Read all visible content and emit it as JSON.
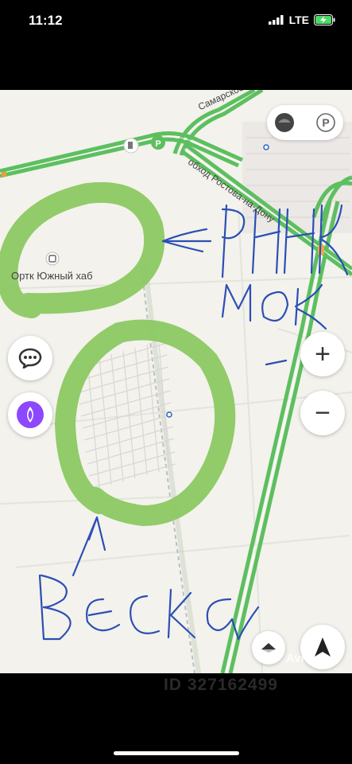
{
  "status_bar": {
    "time": "11:12",
    "network": "LTE"
  },
  "map": {
    "labels": {
      "road_samarskoe": "Самарское",
      "road_bypass": "обход Ростова-на-Дону",
      "poi_hub": "Ортк Южный хаб"
    },
    "handwriting": {
      "annotation_1": "Рынок",
      "annotation_2": "Весна"
    },
    "controls": {
      "zoom_in": "+",
      "zoom_out": "−",
      "chat_icon": "chat-bubble-icon",
      "assistant_icon": "alice-assistant-icon",
      "location_icon": "navigation-arrow-icon",
      "layers_icon": "map-layers-icon",
      "parking_icon": "parking-icon",
      "parking_label": "P"
    },
    "watermark": "Avito",
    "colors": {
      "highway": "#5dbf5f",
      "highlight": "#8cc862",
      "ink": "#2b4fb5",
      "assistant": "#8c47ff"
    }
  },
  "footer": {
    "listing_id": "ID 327162499"
  }
}
